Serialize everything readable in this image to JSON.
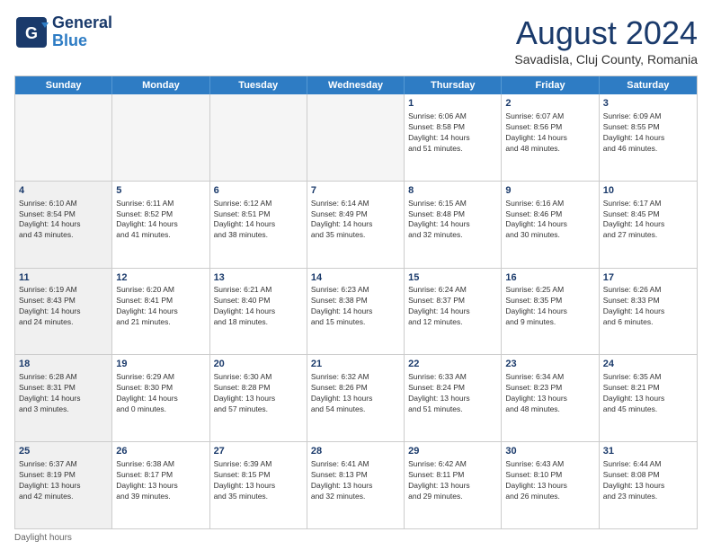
{
  "logo": {
    "general": "General",
    "blue": "Blue"
  },
  "title": "August 2024",
  "location": "Savadisla, Cluj County, Romania",
  "days_header": [
    "Sunday",
    "Monday",
    "Tuesday",
    "Wednesday",
    "Thursday",
    "Friday",
    "Saturday"
  ],
  "footer_note": "Daylight hours",
  "weeks": [
    [
      {
        "day": "",
        "info": "",
        "shaded": true
      },
      {
        "day": "",
        "info": "",
        "shaded": true
      },
      {
        "day": "",
        "info": "",
        "shaded": true
      },
      {
        "day": "",
        "info": "",
        "shaded": true
      },
      {
        "day": "1",
        "info": "Sunrise: 6:06 AM\nSunset: 8:58 PM\nDaylight: 14 hours\nand 51 minutes.",
        "shaded": false
      },
      {
        "day": "2",
        "info": "Sunrise: 6:07 AM\nSunset: 8:56 PM\nDaylight: 14 hours\nand 48 minutes.",
        "shaded": false
      },
      {
        "day": "3",
        "info": "Sunrise: 6:09 AM\nSunset: 8:55 PM\nDaylight: 14 hours\nand 46 minutes.",
        "shaded": false
      }
    ],
    [
      {
        "day": "4",
        "info": "Sunrise: 6:10 AM\nSunset: 8:54 PM\nDaylight: 14 hours\nand 43 minutes.",
        "shaded": true
      },
      {
        "day": "5",
        "info": "Sunrise: 6:11 AM\nSunset: 8:52 PM\nDaylight: 14 hours\nand 41 minutes.",
        "shaded": false
      },
      {
        "day": "6",
        "info": "Sunrise: 6:12 AM\nSunset: 8:51 PM\nDaylight: 14 hours\nand 38 minutes.",
        "shaded": false
      },
      {
        "day": "7",
        "info": "Sunrise: 6:14 AM\nSunset: 8:49 PM\nDaylight: 14 hours\nand 35 minutes.",
        "shaded": false
      },
      {
        "day": "8",
        "info": "Sunrise: 6:15 AM\nSunset: 8:48 PM\nDaylight: 14 hours\nand 32 minutes.",
        "shaded": false
      },
      {
        "day": "9",
        "info": "Sunrise: 6:16 AM\nSunset: 8:46 PM\nDaylight: 14 hours\nand 30 minutes.",
        "shaded": false
      },
      {
        "day": "10",
        "info": "Sunrise: 6:17 AM\nSunset: 8:45 PM\nDaylight: 14 hours\nand 27 minutes.",
        "shaded": false
      }
    ],
    [
      {
        "day": "11",
        "info": "Sunrise: 6:19 AM\nSunset: 8:43 PM\nDaylight: 14 hours\nand 24 minutes.",
        "shaded": true
      },
      {
        "day": "12",
        "info": "Sunrise: 6:20 AM\nSunset: 8:41 PM\nDaylight: 14 hours\nand 21 minutes.",
        "shaded": false
      },
      {
        "day": "13",
        "info": "Sunrise: 6:21 AM\nSunset: 8:40 PM\nDaylight: 14 hours\nand 18 minutes.",
        "shaded": false
      },
      {
        "day": "14",
        "info": "Sunrise: 6:23 AM\nSunset: 8:38 PM\nDaylight: 14 hours\nand 15 minutes.",
        "shaded": false
      },
      {
        "day": "15",
        "info": "Sunrise: 6:24 AM\nSunset: 8:37 PM\nDaylight: 14 hours\nand 12 minutes.",
        "shaded": false
      },
      {
        "day": "16",
        "info": "Sunrise: 6:25 AM\nSunset: 8:35 PM\nDaylight: 14 hours\nand 9 minutes.",
        "shaded": false
      },
      {
        "day": "17",
        "info": "Sunrise: 6:26 AM\nSunset: 8:33 PM\nDaylight: 14 hours\nand 6 minutes.",
        "shaded": false
      }
    ],
    [
      {
        "day": "18",
        "info": "Sunrise: 6:28 AM\nSunset: 8:31 PM\nDaylight: 14 hours\nand 3 minutes.",
        "shaded": true
      },
      {
        "day": "19",
        "info": "Sunrise: 6:29 AM\nSunset: 8:30 PM\nDaylight: 14 hours\nand 0 minutes.",
        "shaded": false
      },
      {
        "day": "20",
        "info": "Sunrise: 6:30 AM\nSunset: 8:28 PM\nDaylight: 13 hours\nand 57 minutes.",
        "shaded": false
      },
      {
        "day": "21",
        "info": "Sunrise: 6:32 AM\nSunset: 8:26 PM\nDaylight: 13 hours\nand 54 minutes.",
        "shaded": false
      },
      {
        "day": "22",
        "info": "Sunrise: 6:33 AM\nSunset: 8:24 PM\nDaylight: 13 hours\nand 51 minutes.",
        "shaded": false
      },
      {
        "day": "23",
        "info": "Sunrise: 6:34 AM\nSunset: 8:23 PM\nDaylight: 13 hours\nand 48 minutes.",
        "shaded": false
      },
      {
        "day": "24",
        "info": "Sunrise: 6:35 AM\nSunset: 8:21 PM\nDaylight: 13 hours\nand 45 minutes.",
        "shaded": false
      }
    ],
    [
      {
        "day": "25",
        "info": "Sunrise: 6:37 AM\nSunset: 8:19 PM\nDaylight: 13 hours\nand 42 minutes.",
        "shaded": true
      },
      {
        "day": "26",
        "info": "Sunrise: 6:38 AM\nSunset: 8:17 PM\nDaylight: 13 hours\nand 39 minutes.",
        "shaded": false
      },
      {
        "day": "27",
        "info": "Sunrise: 6:39 AM\nSunset: 8:15 PM\nDaylight: 13 hours\nand 35 minutes.",
        "shaded": false
      },
      {
        "day": "28",
        "info": "Sunrise: 6:41 AM\nSunset: 8:13 PM\nDaylight: 13 hours\nand 32 minutes.",
        "shaded": false
      },
      {
        "day": "29",
        "info": "Sunrise: 6:42 AM\nSunset: 8:11 PM\nDaylight: 13 hours\nand 29 minutes.",
        "shaded": false
      },
      {
        "day": "30",
        "info": "Sunrise: 6:43 AM\nSunset: 8:10 PM\nDaylight: 13 hours\nand 26 minutes.",
        "shaded": false
      },
      {
        "day": "31",
        "info": "Sunrise: 6:44 AM\nSunset: 8:08 PM\nDaylight: 13 hours\nand 23 minutes.",
        "shaded": false
      }
    ]
  ]
}
